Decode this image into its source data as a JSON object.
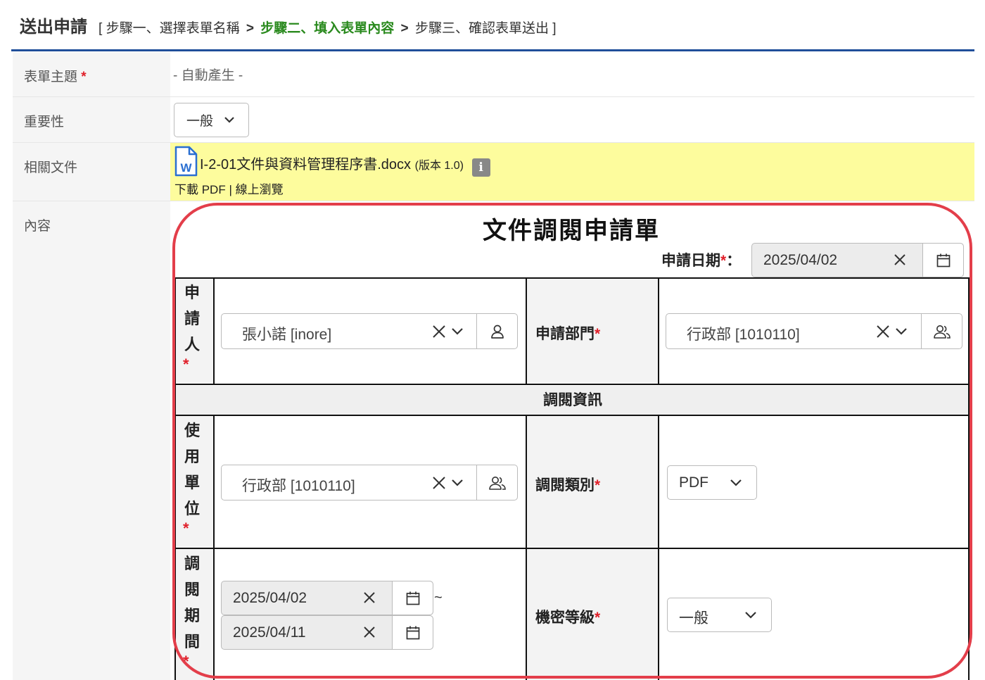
{
  "header": {
    "title": "送出申請",
    "bracket_open": "[",
    "step1": "步驟一、選擇表單名稱",
    "step2": "步驟二、填入表單內容",
    "step3": "步驟三、確認表單送出",
    "bracket_close": "]",
    "sep": ">"
  },
  "rows": {
    "subject": {
      "label": "表單主題",
      "req": "*",
      "value": "- 自動產生 -"
    },
    "importance": {
      "label": "重要性",
      "value": "一般"
    },
    "related_docs": {
      "label": "相關文件",
      "file_name": "I-2-01文件與資料管理程序書.docx",
      "version": "(版本 1.0)",
      "info_icon_text": "i",
      "download_pdf": "下載 PDF",
      "divider": "|",
      "online_view": "線上瀏覽"
    },
    "content": {
      "label": "內容"
    }
  },
  "form": {
    "title": "文件調閱申請單",
    "apply_date": {
      "label": "申請日期",
      "req": "*",
      "colon": "：",
      "value": "2025/04/02"
    },
    "applicant": {
      "label_chars": [
        "申",
        "請",
        "人"
      ],
      "req": "*",
      "value": "張小諾 [inore]"
    },
    "department": {
      "label": "申請部門",
      "req": "*",
      "value": "行政部 [1010110]"
    },
    "section": "調閱資訊",
    "using_unit": {
      "label_chars": [
        "使",
        "用",
        "單",
        "位"
      ],
      "req": "*",
      "value": "行政部 [1010110]"
    },
    "access_type": {
      "label": "調閱類別",
      "req": "*",
      "value": "PDF"
    },
    "period": {
      "label_chars": [
        "調",
        "閱",
        "期",
        "間"
      ],
      "req": "*",
      "start": "2025/04/02",
      "end": "2025/04/11",
      "tilde": "~"
    },
    "confidentiality": {
      "label": "機密等級",
      "req": "*",
      "value": "一般"
    }
  },
  "colors": {
    "accent_blue": "#1f4e9a",
    "current_step": "#2a8a1e",
    "required": "#e0202a",
    "highlight": "#fdfc9d",
    "frame": "#e33e4a"
  }
}
